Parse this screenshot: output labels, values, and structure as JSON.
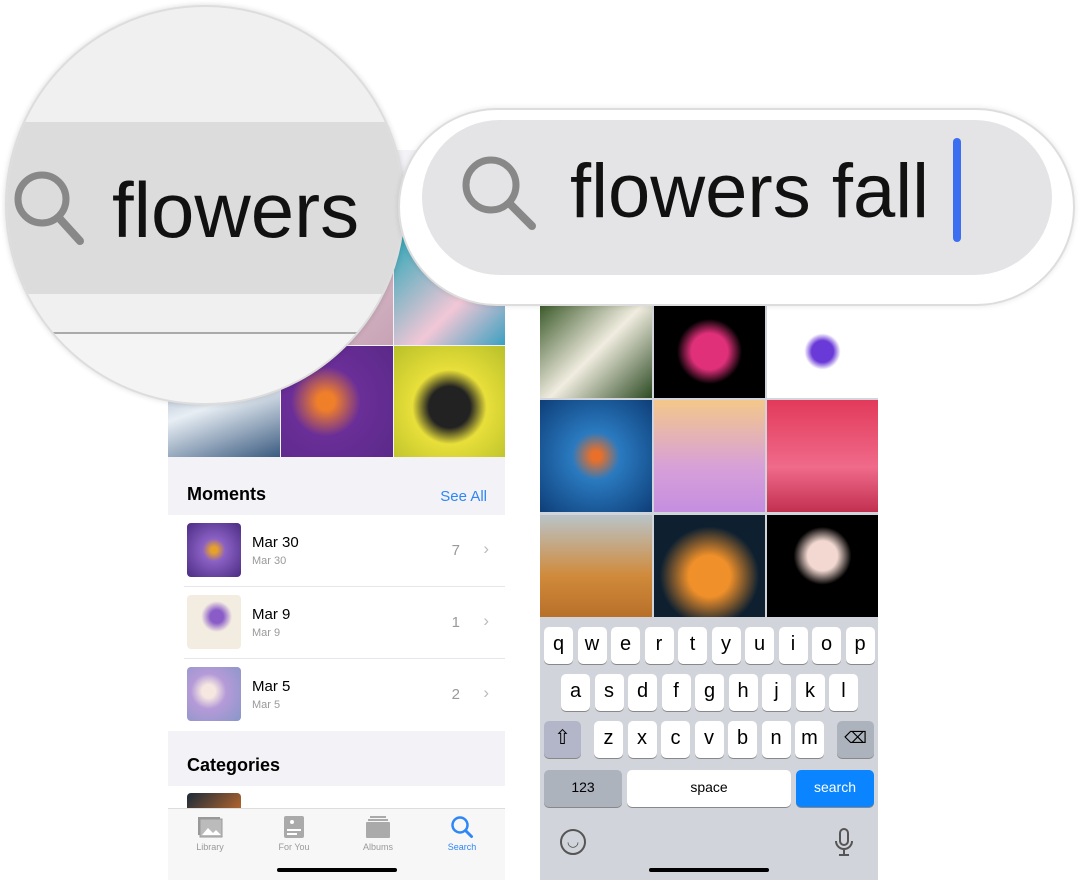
{
  "left_phone": {
    "moments": {
      "title": "Moments",
      "see_all": "See All",
      "items": [
        {
          "date": "Mar 30",
          "sub": "Mar 30",
          "count": "7"
        },
        {
          "date": "Mar 9",
          "sub": "Mar 9",
          "count": "1"
        },
        {
          "date": "Mar 5",
          "sub": "Mar 5",
          "count": "2"
        }
      ]
    },
    "categories": {
      "title": "Categories"
    },
    "tabs": [
      {
        "label": "Library",
        "icon": "photo-library-icon"
      },
      {
        "label": "For You",
        "icon": "for-you-icon"
      },
      {
        "label": "Albums",
        "icon": "albums-icon"
      },
      {
        "label": "Search",
        "icon": "search-icon",
        "active": true
      }
    ],
    "accent": "#2f86f6"
  },
  "magnifier_left": {
    "query": "flowers"
  },
  "magnifier_right": {
    "query": "flowers fall",
    "cursor_color": "#3b6ef0"
  },
  "keyboard": {
    "rows": [
      [
        "q",
        "w",
        "e",
        "r",
        "t",
        "y",
        "u",
        "i",
        "o",
        "p"
      ],
      [
        "a",
        "s",
        "d",
        "f",
        "g",
        "h",
        "j",
        "k",
        "l"
      ],
      [
        "z",
        "x",
        "c",
        "v",
        "b",
        "n",
        "m"
      ]
    ],
    "numbers": "123",
    "space": "space",
    "search": "search",
    "search_color": "#0a84ff"
  }
}
